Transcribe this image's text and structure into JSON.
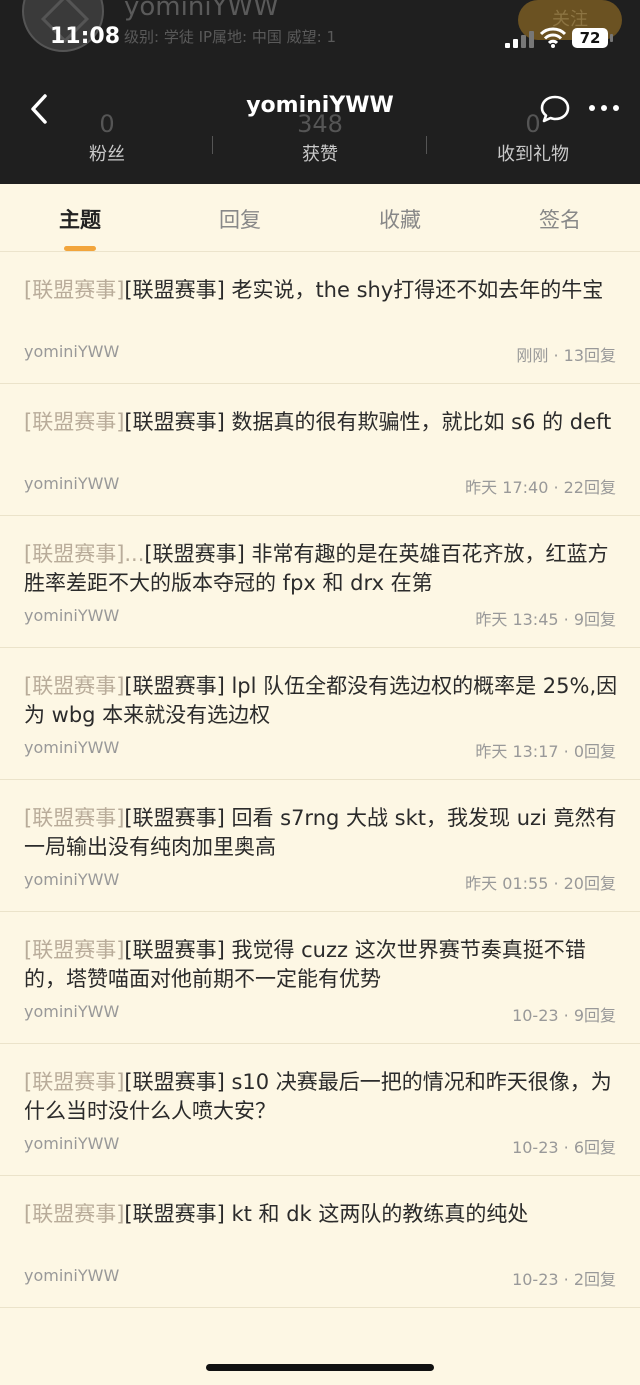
{
  "status_bar": {
    "time": "11:08",
    "battery": "72"
  },
  "profile_background": {
    "username": "yominiYWW",
    "meta": "级别: 学徒  IP属地: 中国  威望: 1",
    "follow_label": "关注"
  },
  "nav": {
    "title": "yominiYWW"
  },
  "stats": [
    {
      "value": "0",
      "label": "粉丝"
    },
    {
      "value": "348",
      "label": "获赞"
    },
    {
      "value": "0",
      "label": "收到礼物"
    }
  ],
  "tabs": [
    {
      "label": "主题",
      "active": true
    },
    {
      "label": "回复",
      "active": false
    },
    {
      "label": "收藏",
      "active": false
    },
    {
      "label": "签名",
      "active": false
    }
  ],
  "posts": [
    {
      "tag": "[联盟赛事]",
      "title": "[联盟赛事] 老实说，the shy打得还不如去年的牛宝",
      "author": "yominiYWW",
      "meta": "刚刚 · 13回复"
    },
    {
      "tag": "[联盟赛事]",
      "title": "[联盟赛事] 数据真的很有欺骗性，就比如 s6 的 deft",
      "author": "yominiYWW",
      "meta": "昨天 17:40 · 22回复"
    },
    {
      "tag": "[联盟赛事]...",
      "title": "[联盟赛事] 非常有趣的是在英雄百花齐放，红蓝方胜率差距不大的版本夺冠的 fpx 和 drx 在第",
      "author": "yominiYWW",
      "meta": "昨天 13:45 · 9回复"
    },
    {
      "tag": "[联盟赛事]",
      "title": "[联盟赛事] lpl 队伍全都没有选边权的概率是 25%,因为 wbg 本来就没有选边权",
      "author": "yominiYWW",
      "meta": "昨天 13:17 · 0回复"
    },
    {
      "tag": "[联盟赛事]",
      "title": "[联盟赛事] 回看 s7rng 大战 skt，我发现 uzi 竟然有一局输出没有纯肉加里奥高",
      "author": "yominiYWW",
      "meta": "昨天 01:55 · 20回复"
    },
    {
      "tag": "[联盟赛事]",
      "title": "[联盟赛事] 我觉得 cuzz 这次世界赛节奏真挺不错的，塔赞喵面对他前期不一定能有优势",
      "author": "yominiYWW",
      "meta": "10-23 · 9回复"
    },
    {
      "tag": "[联盟赛事]",
      "title": "[联盟赛事] s10 决赛最后一把的情况和昨天很像，为什么当时没什么人喷大安？",
      "author": "yominiYWW",
      "meta": "10-23 · 6回复"
    },
    {
      "tag": "[联盟赛事]",
      "title": "[联盟赛事] kt 和 dk 这两队的教练真的纯处",
      "author": "yominiYWW",
      "meta": "10-23 · 2回复"
    }
  ]
}
